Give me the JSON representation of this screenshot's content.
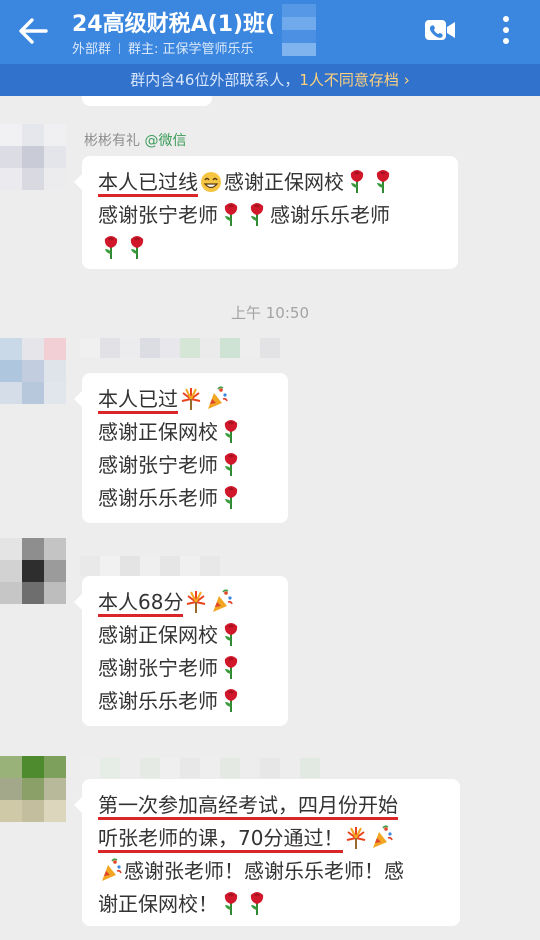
{
  "header": {
    "title": "24高级财税A(1)班(",
    "subtitle_tag": "外部群",
    "subtitle_owner": "群主: 正保学管师乐乐"
  },
  "notice": {
    "text_prefix": "群内含46位外部联系人，",
    "text_highlight": "1人不同意存档",
    "chevron": "›"
  },
  "messages": [
    {
      "sender": "彬彬有礼",
      "source": "@微信",
      "lines": [
        {
          "underlined": "本人已过线",
          "rest": "感谢正保网校",
          "emoji_after_ul": "grin-emoji",
          "tail_emojis": 2
        },
        {
          "text": "感谢张宁老师",
          "mid": "感谢乐乐老师"
        },
        {
          "text": ""
        }
      ]
    },
    {
      "lines": [
        "本人已过",
        "感谢正保网校",
        "感谢张宁老师",
        "感谢乐乐老师"
      ]
    },
    {
      "lines": [
        "本人68分",
        "感谢正保网校",
        "感谢张宁老师",
        "感谢乐乐老师"
      ]
    },
    {
      "lines": [
        "第一次参加高经考试，四月份开始",
        "听张老师的课，70分通过！",
        "感谢张老师！感谢乐乐老师！感",
        "谢正保网校！"
      ]
    }
  ],
  "timestamp": "上午 10:50",
  "colors": {
    "header": "#3b87e0",
    "notice": "#3172cc",
    "underline": "#d9262b",
    "source": "#3a9b57"
  },
  "icons": [
    "back-arrow-icon",
    "video-call-icon",
    "more-menu-icon",
    "rose-icon",
    "party-popper-icon",
    "fireworks-icon",
    "grin-emoji-icon"
  ]
}
